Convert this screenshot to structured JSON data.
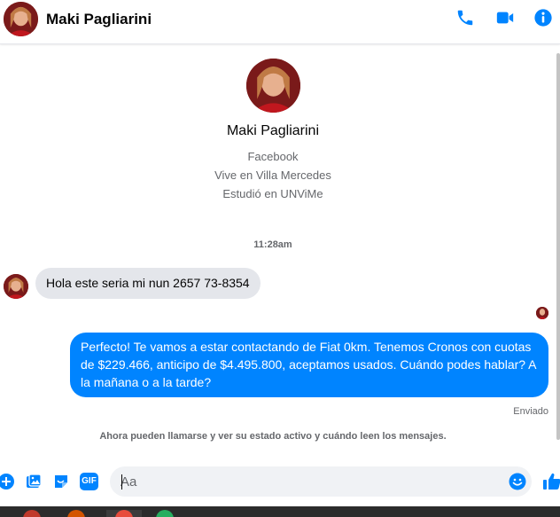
{
  "header": {
    "name": "Maki Pagliarini",
    "icons": [
      "phone-icon",
      "video-camera-icon",
      "info-icon"
    ],
    "accent": "#0084ff"
  },
  "profile": {
    "name": "Maki Pagliarini",
    "lines": [
      "Facebook",
      "Vive en Villa Mercedes",
      "Estudió en UNViMe"
    ]
  },
  "conversation": {
    "timestamp": "11:28am",
    "incoming": "Hola  este seria mi nun  2657 73-8354",
    "outgoing": "Perfecto! Te vamos a estar contactando de Fiat 0km. Tenemos Cronos con cuotas de $229.466, anticipo de $4.495.800, aceptamos usados. Cuándo podes hablar? A la mañana o a la tarde?",
    "status": "Enviado",
    "info": "Ahora pueden llamarse y ver su estado activo y cuándo leen los mensajes."
  },
  "composer": {
    "placeholder": "Aa",
    "icons": [
      "add-icon",
      "photo-icon",
      "sticker-icon",
      "gif-icon",
      "emoji-icon",
      "like-icon"
    ],
    "gif_label": "GIF"
  },
  "colors": {
    "bubble_out": "#0084ff",
    "bubble_in": "#e4e6eb",
    "secondary_text": "#65676b"
  }
}
